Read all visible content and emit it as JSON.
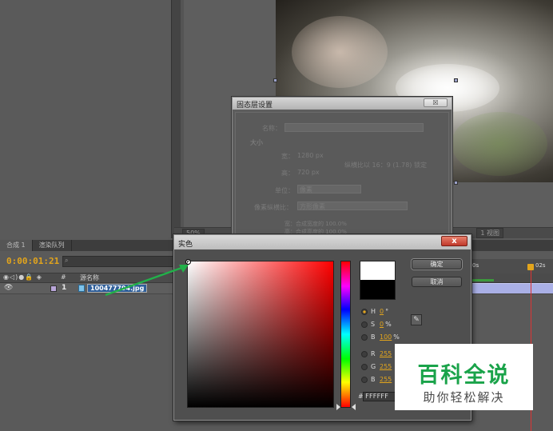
{
  "solid_dialog": {
    "title": "固态层设置",
    "close_label": "☒",
    "name_label": "名称：",
    "size_heading": "大小",
    "width_label": "宽：",
    "width_value": "1280 px",
    "aspect_lock_label": "纵横比以 16：9 (1.78) 锁定",
    "height_label": "高：",
    "height_value": "720 px",
    "unit_label": "单位：",
    "unit_value": "像素",
    "pixel_aspect_label": "像素纵横比：",
    "pixel_aspect_value": "方形像素",
    "width_pct": "宽：合成宽度的 100.0%",
    "height_pct": "高：合成高度的 100.0%"
  },
  "viewer": {
    "zoom": "50%",
    "view_label": "1 视图"
  },
  "timeline": {
    "tabs": [
      "合成 1",
      "渲染队列"
    ],
    "timecode": "0:00:01:21",
    "search_placeholder": "",
    "header_hash": "#",
    "header_name": "源名称",
    "layer_number": "1",
    "layer_name": "100477794.jpg",
    "ruler_start": "0s",
    "ruler_end": "02s"
  },
  "color_dialog": {
    "title": "实色",
    "close_label": "x",
    "ok_label": "确定",
    "cancel_label": "取消",
    "selected_color": "#ffffff",
    "previous_color": "#000000",
    "hue_max_color": "#ff0000",
    "fields": [
      {
        "label": "H",
        "value": "0",
        "unit": "°",
        "selected": true
      },
      {
        "label": "S",
        "value": "0",
        "unit": "%",
        "selected": false
      },
      {
        "label": "B",
        "value": "100",
        "unit": "%",
        "selected": false
      },
      {
        "label": "R",
        "value": "255",
        "unit": "",
        "selected": false
      },
      {
        "label": "G",
        "value": "255",
        "unit": "",
        "selected": false
      },
      {
        "label": "B",
        "value": "255",
        "unit": "",
        "selected": false
      }
    ],
    "hex_hash": "#",
    "hex_value": "FFFFFF"
  },
  "watermark": {
    "title": "百科全说",
    "subtitle": "助你轻松解决"
  },
  "colors": {
    "accent_orange": "#e3a51c",
    "layer_bar": "#aab0e6",
    "watermark_green": "#1aa34a"
  }
}
